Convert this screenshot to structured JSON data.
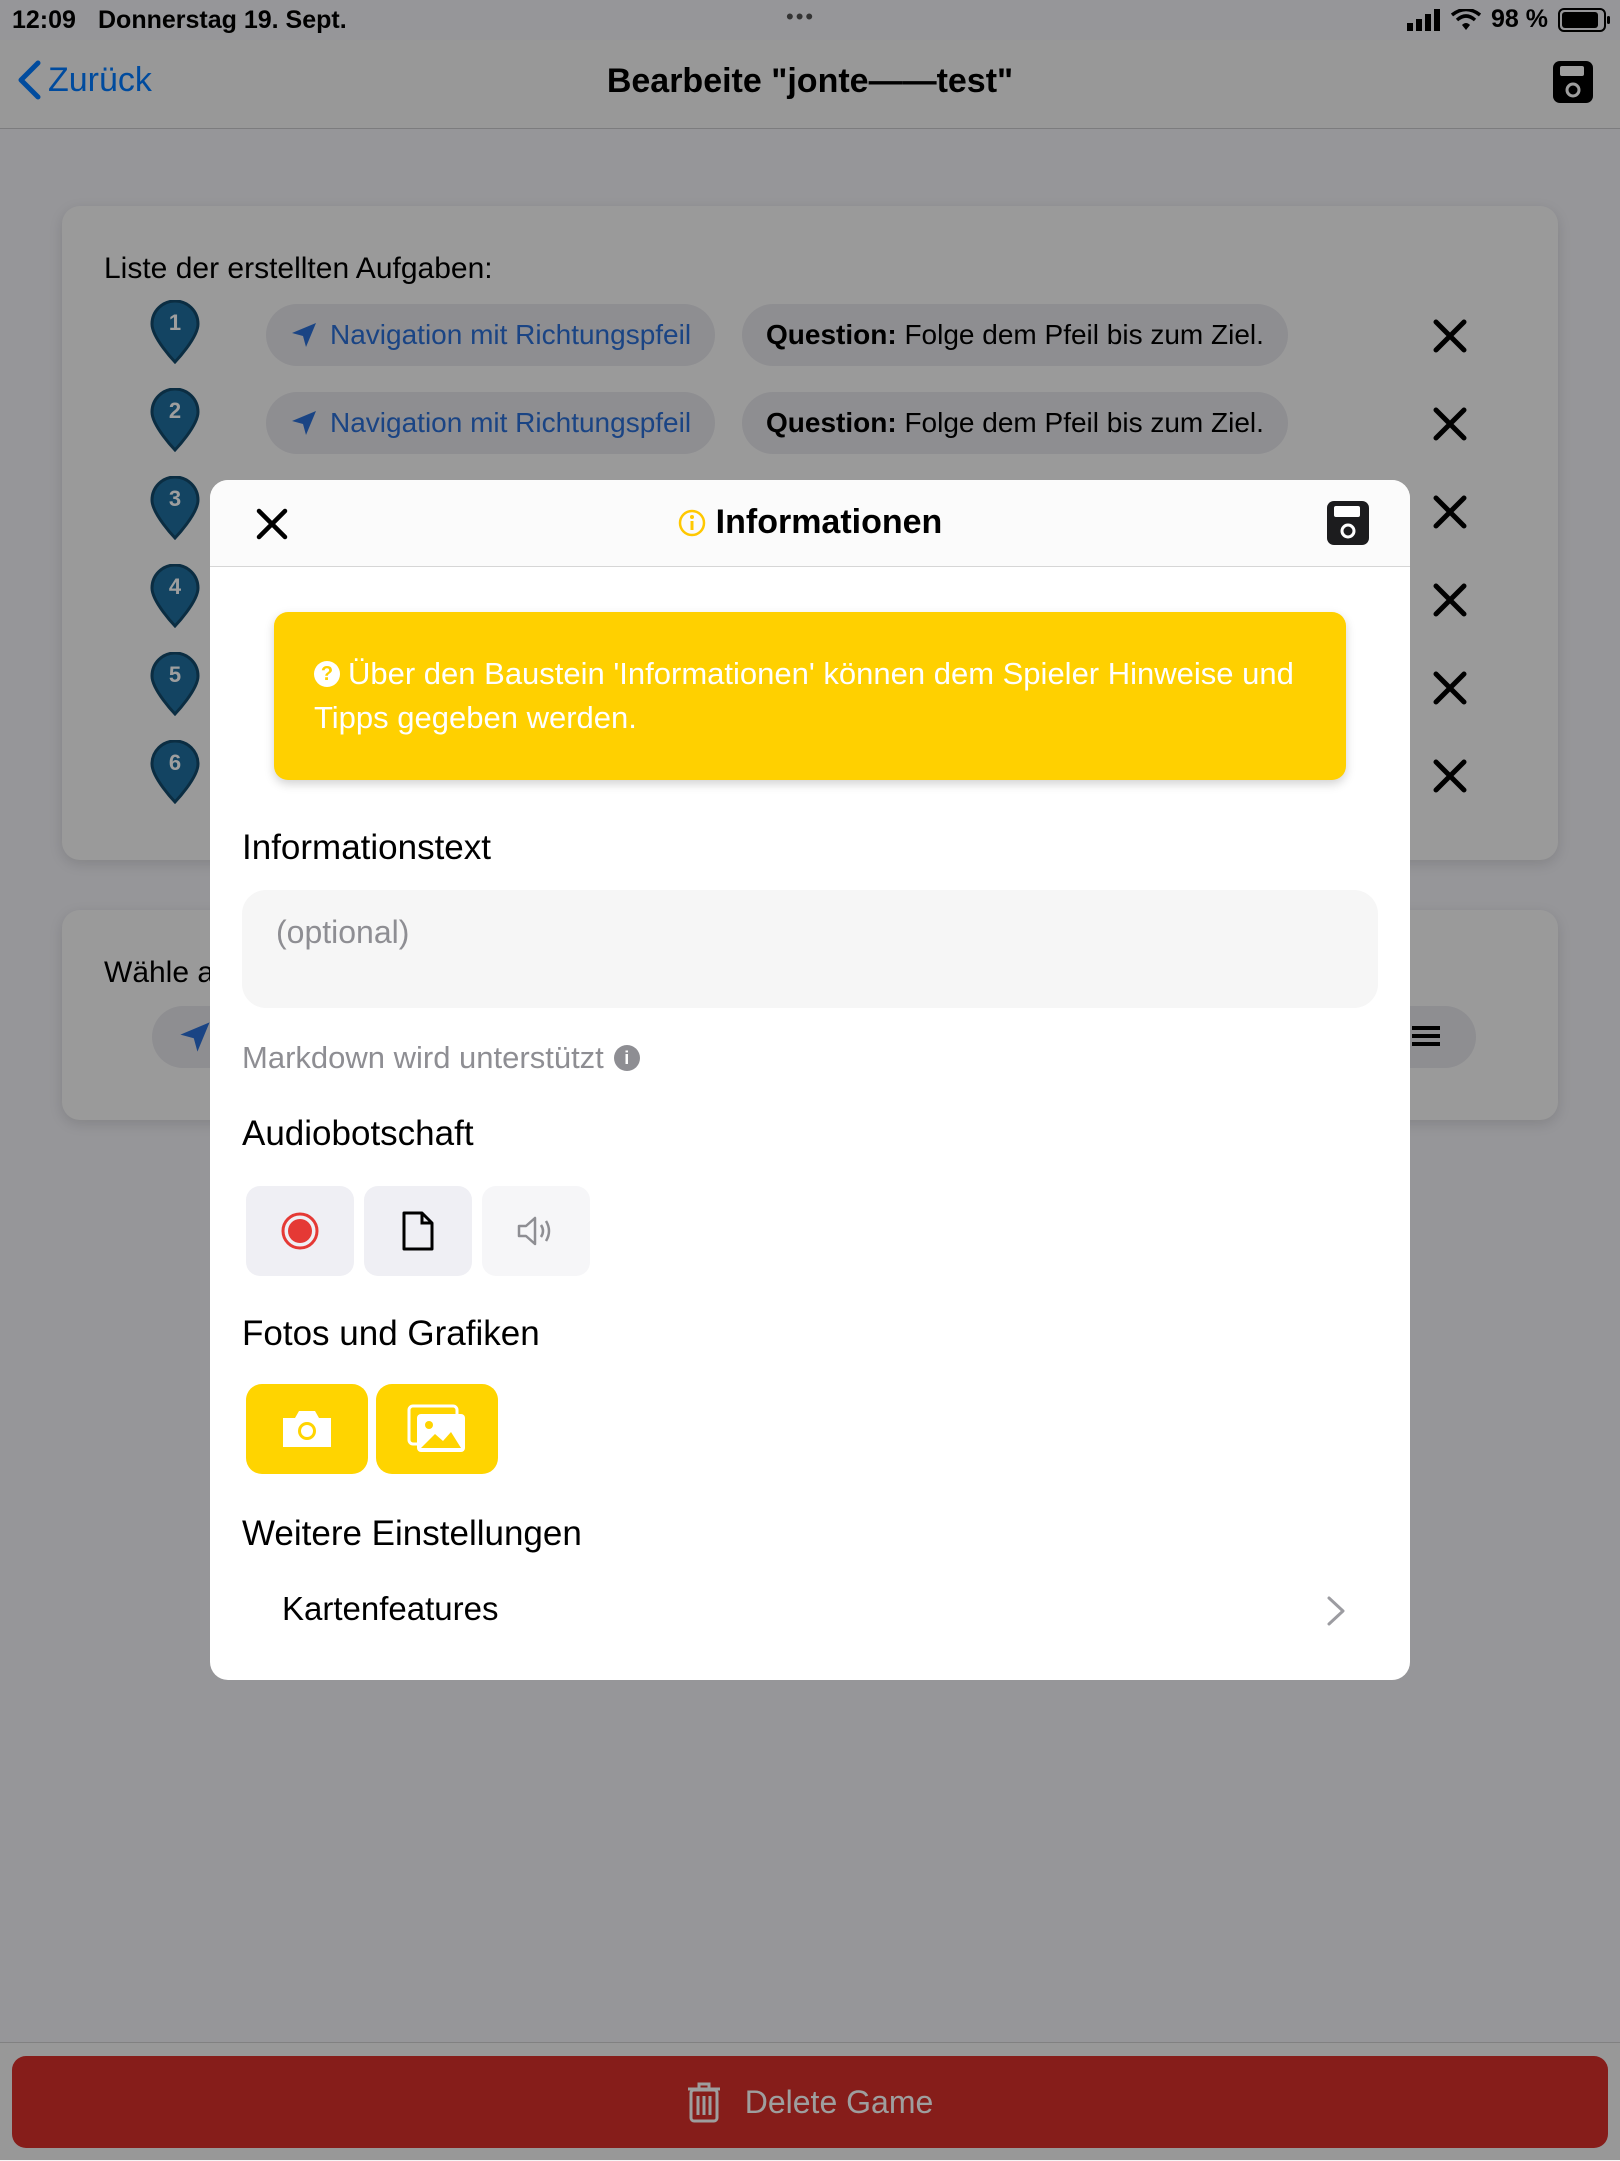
{
  "status_bar": {
    "time": "12:09",
    "date": "Donnerstag 19. Sept.",
    "battery": "98 %"
  },
  "nav": {
    "back_label": "Zurück",
    "title": "Bearbeite \"jonte——test\""
  },
  "task_list": {
    "title": "Liste der erstellten Aufgaben:",
    "items": [
      {
        "number": "1",
        "type_label": "Navigation mit Richtungspfeil",
        "question_label": "Question:",
        "question_text": "Folge dem Pfeil bis zum Ziel."
      },
      {
        "number": "2",
        "type_label": "Navigation mit Richtungspfeil",
        "question_label": "Question:",
        "question_text": "Folge dem Pfeil bis zum Ziel."
      },
      {
        "number": "3"
      },
      {
        "number": "4"
      },
      {
        "number": "5"
      },
      {
        "number": "6"
      }
    ]
  },
  "choose_card": {
    "title": "Wähle a"
  },
  "delete_button": "Delete Game",
  "modal": {
    "title": "Informationen",
    "notice": "Über den Baustein 'Informationen' können dem Spieler Hinweise und Tipps gegeben werden.",
    "info_text_section": "Informationstext",
    "info_text_placeholder": "(optional)",
    "markdown_hint": "Markdown wird unterstützt",
    "audio_section": "Audiobotschaft",
    "photos_section": "Fotos und Grafiken",
    "settings_section": "Weitere Einstellungen",
    "settings_row": "Kartenfeatures"
  },
  "colors": {
    "accent_yellow": "#ffd000",
    "delete_red": "#d8302b",
    "nav_blue": "#2b6fd6",
    "pin_blue": "#1f6f9e"
  }
}
